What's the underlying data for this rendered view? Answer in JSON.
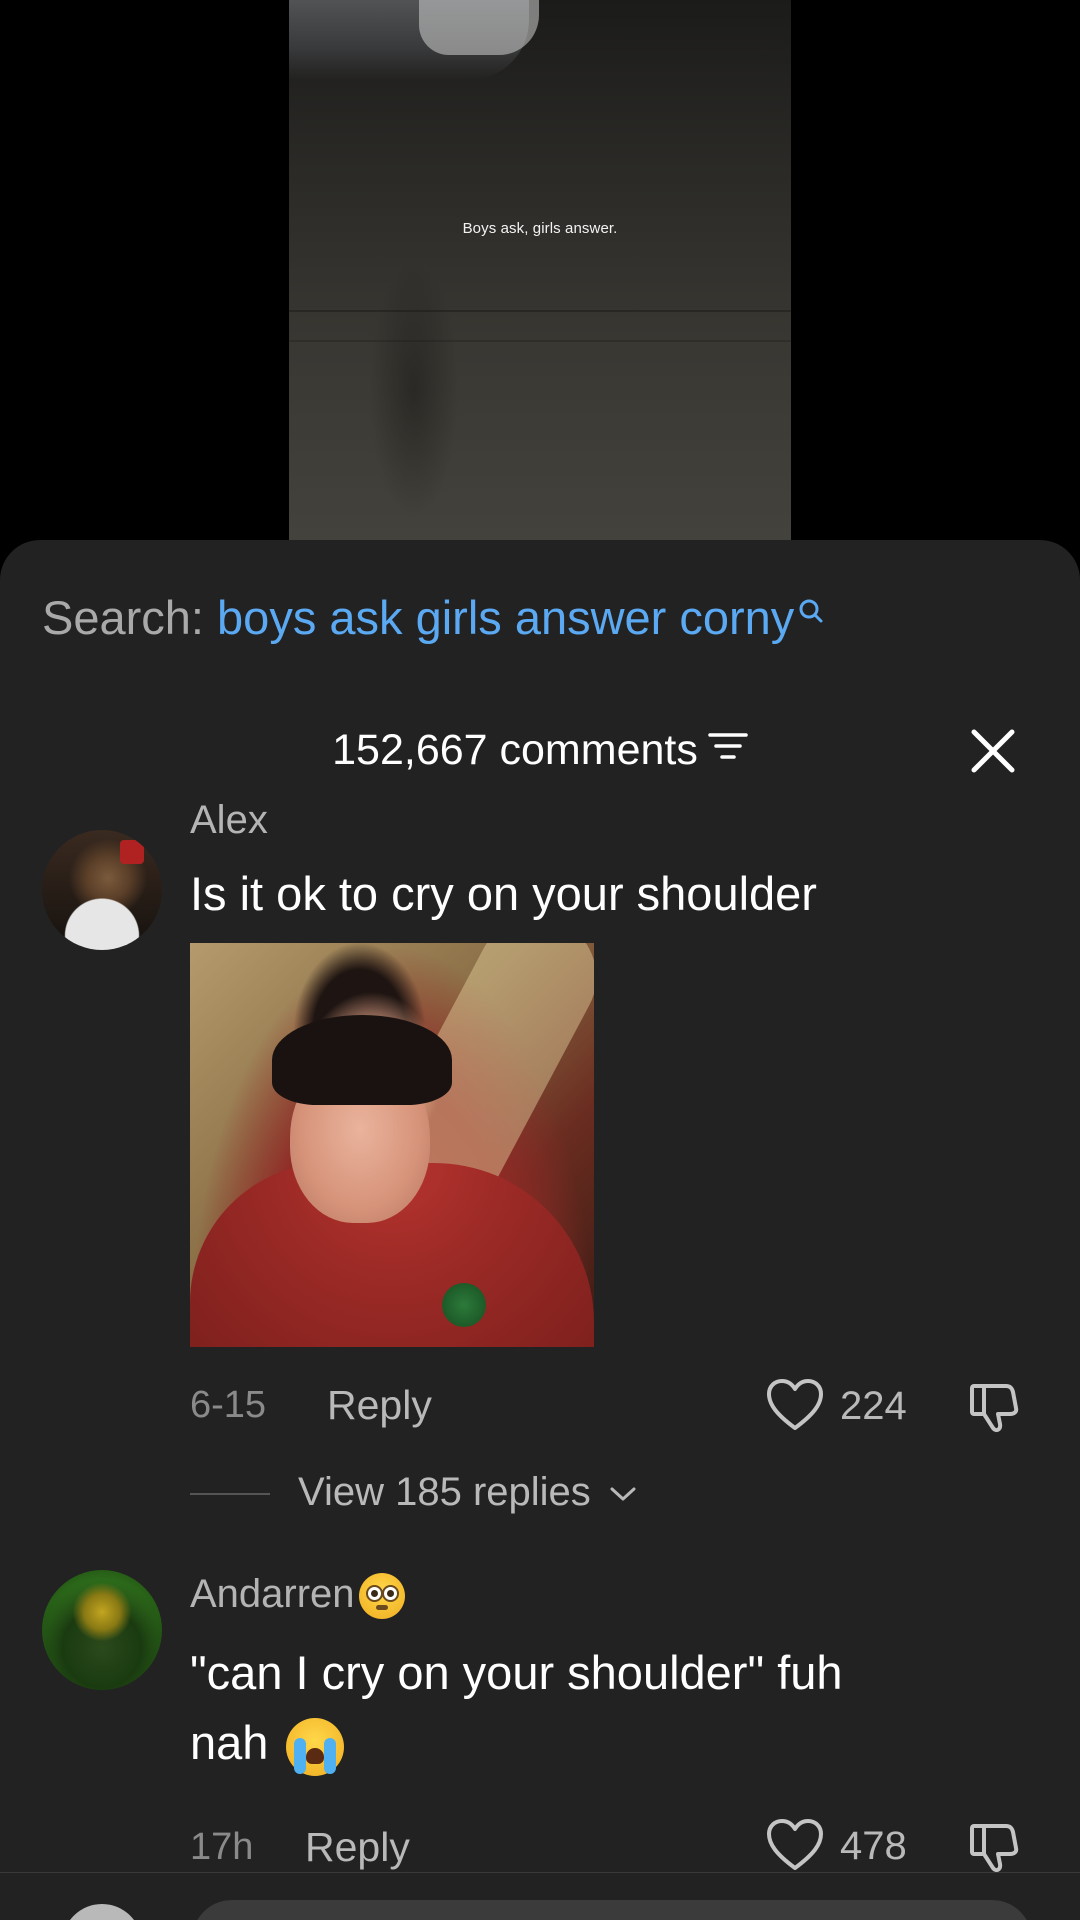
{
  "video": {
    "caption": "Boys ask, girls answer."
  },
  "search": {
    "prefix": "Search:",
    "query": "boys ask girls answer corny"
  },
  "header": {
    "comment_count": "152,667 comments"
  },
  "comments": [
    {
      "username": "Alex",
      "text": "Is it ok to cry on your shoulder",
      "date": "6-15",
      "reply_label": "Reply",
      "likes": "224",
      "view_replies": "View 185 replies"
    },
    {
      "username": "Andarren",
      "text_line1": "\"can I cry on your shoulder\" fuh",
      "text_line2": "nah",
      "date": "17h",
      "reply_label": "Reply",
      "likes": "478"
    }
  ],
  "colors": {
    "accent": "#5aa9f2",
    "sheet_bg": "#222222"
  }
}
